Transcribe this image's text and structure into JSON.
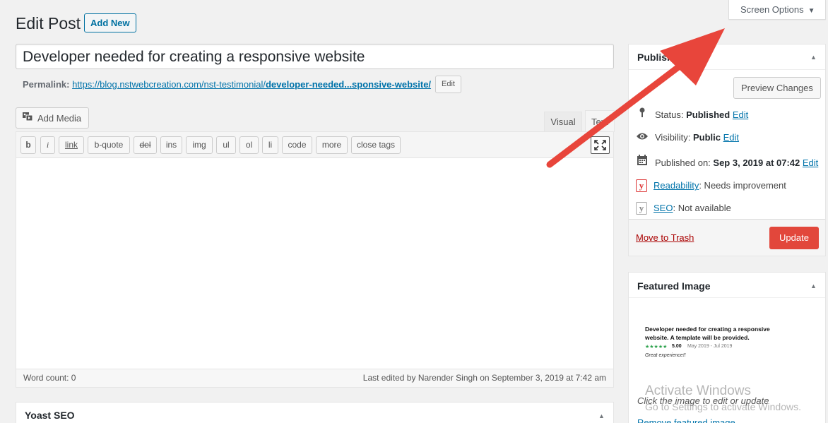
{
  "header": {
    "title": "Edit Post",
    "add_new": "Add New",
    "screen_options": "Screen Options",
    "screen_options_caret": "▼"
  },
  "post": {
    "title_value": "Developer needed for creating a responsive website",
    "permalink_label": "Permalink:",
    "permalink_base": "https://blog.nstwebcreation.com/nst-testimonial/",
    "permalink_slug": "developer-needed...sponsive-website/",
    "permalink_edit": "Edit"
  },
  "editor": {
    "add_media": "Add Media",
    "tabs": [
      "Visual",
      "Text"
    ],
    "quicktags": [
      "b",
      "i",
      "link",
      "b-quote",
      "del",
      "ins",
      "img",
      "ul",
      "ol",
      "li",
      "code",
      "more",
      "close tags"
    ],
    "word_count": "Word count: 0",
    "last_edited": "Last edited by Narender Singh on September 3, 2019 at 7:42 am"
  },
  "yoast": {
    "title": "Yoast SEO",
    "toggle": "▲"
  },
  "publish": {
    "title": "Publish",
    "toggle": "▲",
    "preview": "Preview Changes",
    "status_label": "Status:",
    "status_value": "Published",
    "visibility_label": "Visibility:",
    "visibility_value": "Public",
    "published_label": "Published on:",
    "published_value": "Sep 3, 2019 at 07:42",
    "edit": "Edit",
    "readability_link": "Readability",
    "readability_value": ": Needs improvement",
    "seo_link": "SEO",
    "seo_value": ": Not available",
    "trash": "Move to Trash",
    "update": "Update"
  },
  "featured": {
    "title": "Featured Image",
    "toggle": "▲",
    "thumb_heading": "Developer needed for creating a responsive website. A template will be provided.",
    "thumb_stars": "★★★★★",
    "thumb_score": "5.00",
    "thumb_dates": "May 2019 - Jul 2019",
    "thumb_review": "Great experience!!",
    "click_hint": "Click the image to edit or update",
    "remove": "Remove featured image"
  },
  "watermark": {
    "line1": "Activate Windows",
    "line2": "Go to Settings to activate Windows."
  },
  "colors": {
    "accent": "#0073aa",
    "update_button": "#e2473b",
    "arrow": "#e8453b"
  }
}
